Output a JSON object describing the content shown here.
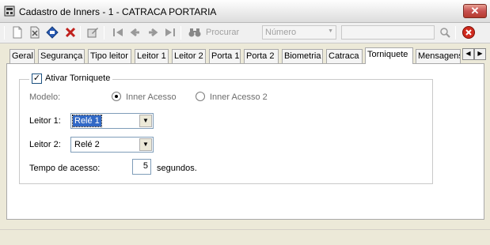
{
  "window": {
    "title": "Cadastro de Inners - 1 - CATRACA PORTARIA",
    "close_label": "✕"
  },
  "toolbar": {
    "buttons": [
      "new-document-icon",
      "cancel-document-icon",
      "save-icon",
      "delete-icon",
      "edit-icon",
      "first-record-icon",
      "previous-record-icon",
      "next-record-icon",
      "last-record-icon",
      "binoculars-icon",
      "magnifier-icon",
      "exit-icon"
    ],
    "search_label": "Procurar",
    "field_select_value": "Número",
    "search_value": ""
  },
  "tabs": [
    {
      "label": "Geral"
    },
    {
      "label": "Segurança"
    },
    {
      "label": "Tipo leitor"
    },
    {
      "label": "Leitor 1"
    },
    {
      "label": "Leitor 2"
    },
    {
      "label": "Porta 1"
    },
    {
      "label": "Porta 2"
    },
    {
      "label": "Biometria"
    },
    {
      "label": "Catraca"
    },
    {
      "label": "Torniquete"
    },
    {
      "label": "Mensagens"
    }
  ],
  "active_tab": "Torniquete",
  "torniquete": {
    "enable_label": "Ativar Torniquete",
    "enabled": true,
    "model_label": "Modelo:",
    "model_options": [
      "Inner Acesso",
      "Inner Acesso 2"
    ],
    "model_selected": "Inner Acesso",
    "reader1_label": "Leitor 1:",
    "reader1_value": "Relé 1",
    "reader2_label": "Leitor 2:",
    "reader2_value": "Relé 2",
    "access_time_label": "Tempo de acesso:",
    "access_time_value": "5",
    "access_time_unit": "segundos."
  },
  "colors": {
    "selection": "#3169c6",
    "close_button": "#c75050",
    "exit_icon": "#d02a1e"
  }
}
